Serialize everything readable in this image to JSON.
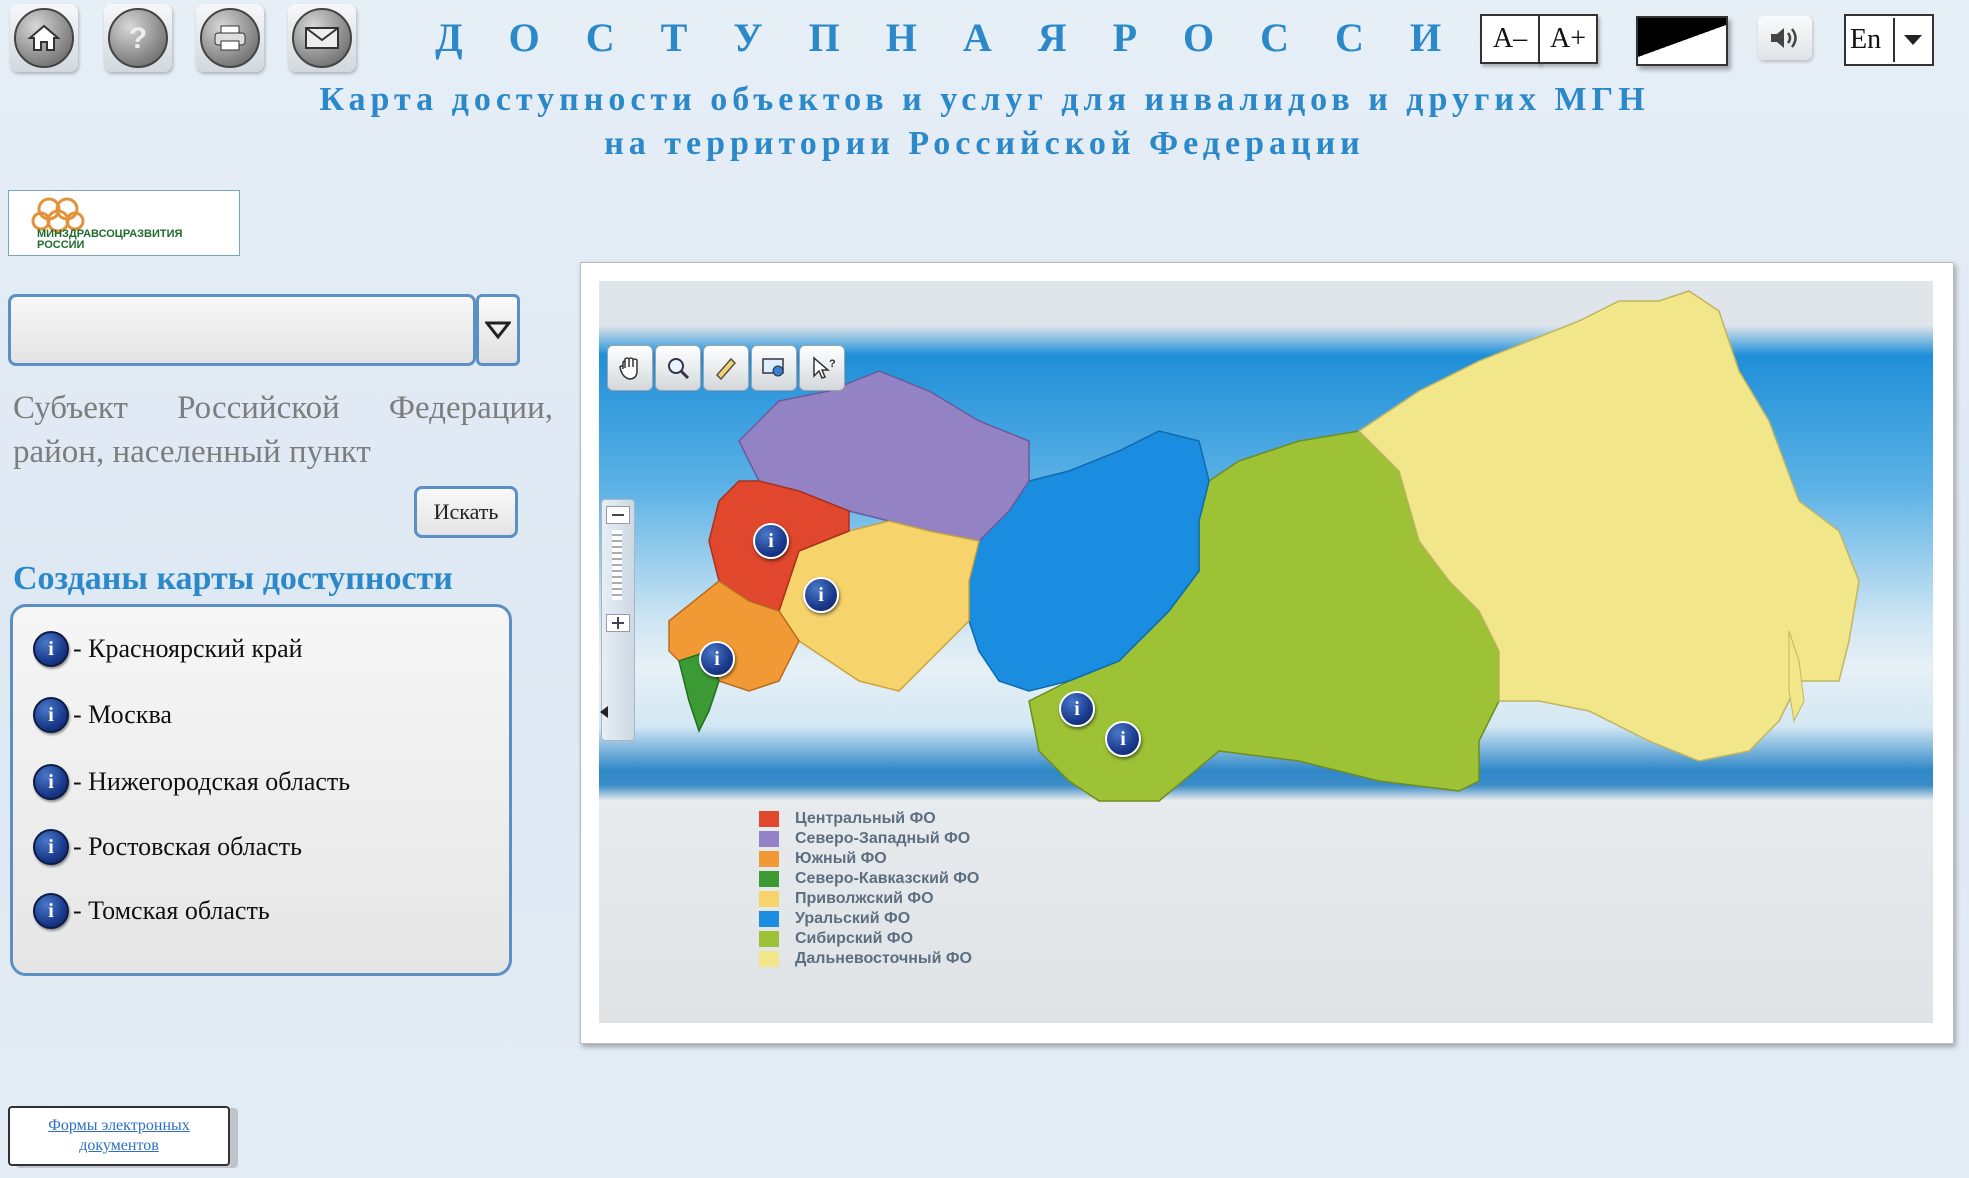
{
  "header": {
    "title": "Д О С Т У П Н А Я   Р О С С И Я",
    "subtitle_line1": "Карта доступности объектов и услуг для инвалидов и других МГН",
    "subtitle_line2": "на территории Российской Федерации",
    "icons": [
      "home-icon",
      "help-icon",
      "print-icon",
      "mail-icon"
    ],
    "font_decrease": "A–",
    "font_increase": "A+",
    "language": "En"
  },
  "logo": {
    "text_line1": "МИНЗДРАВСОЦРАЗВИТИЯ",
    "text_line2": "РОССИИ"
  },
  "search": {
    "hint": "Субъект Российской Федерации, район, населенный пункт",
    "button": "Искать"
  },
  "created": {
    "title": "Созданы карты доступности",
    "items": [
      "- Красноярский край",
      "- Москва",
      "- Нижегородская область",
      "- Ростовская область",
      "- Томская область"
    ]
  },
  "footer": {
    "forms_link": "Формы электронных документов"
  },
  "map": {
    "legend": [
      {
        "label": "Центральный ФО",
        "color": "#e0472c"
      },
      {
        "label": "Северо-Западный ФО",
        "color": "#9483c4"
      },
      {
        "label": "Южный ФО",
        "color": "#f19a35"
      },
      {
        "label": "Северо-Кавказский ФО",
        "color": "#3c9a35"
      },
      {
        "label": "Приволжский ФО",
        "color": "#f7d36b"
      },
      {
        "label": "Уральский ФО",
        "color": "#1a8de0"
      },
      {
        "label": "Сибирский ФО",
        "color": "#9dc235"
      },
      {
        "label": "Дальневосточный ФО",
        "color": "#f1e68a"
      }
    ],
    "marker_glyph": "i"
  }
}
